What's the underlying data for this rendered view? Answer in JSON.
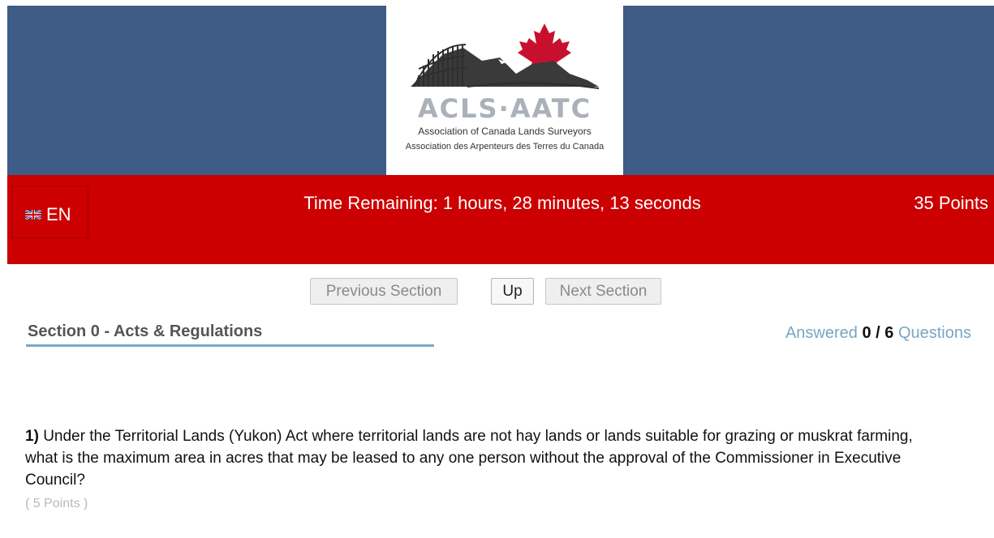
{
  "header": {
    "logo": {
      "acronym": "ACLS·AATC",
      "name_en": "Association of Canada Lands Surveyors",
      "name_fr": "Association des Arpenteurs des Terres du Canada"
    }
  },
  "status_bar": {
    "language": {
      "icon": "uk-flag-icon",
      "code": "EN"
    },
    "timer": "Time Remaining: 1 hours, 28 minutes, 13 seconds",
    "points": "35 Points"
  },
  "navigation": {
    "previous_label": "Previous Section",
    "up_label": "Up",
    "next_label": "Next Section"
  },
  "section": {
    "title": "Section 0 - Acts & Regulations",
    "answered_prefix": "Answered",
    "answered_count": "0 / 6",
    "answered_suffix": "Questions"
  },
  "question": {
    "number": "1)",
    "text": "Under the Territorial Lands (Yukon) Act where territorial lands are not hay lands or lands suitable for grazing or muskrat farming, what is the maximum area in acres that may be leased to any one person without the approval of the Commissioner in Executive Council?",
    "points": "( 5 Points )"
  },
  "colors": {
    "header_blue": "#3e5c85",
    "status_red": "#cc0000",
    "link_blue": "#79a6c4",
    "maple_red": "#c8102e"
  }
}
